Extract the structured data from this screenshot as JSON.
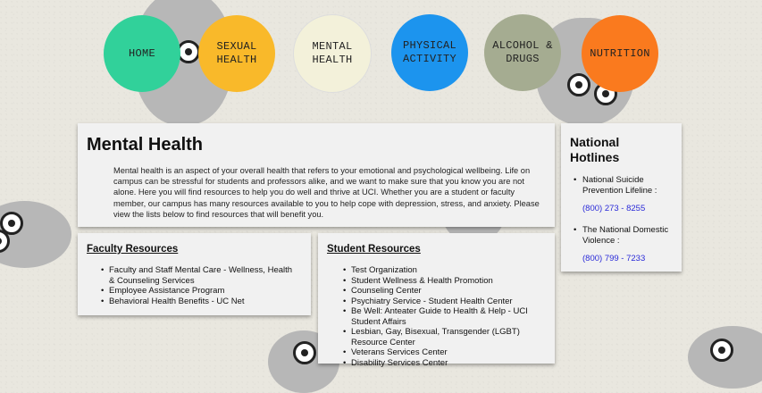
{
  "nav": [
    {
      "label": "HOME",
      "color": "#31d19a"
    },
    {
      "label": "SEXUAL HEALTH",
      "color": "#f9b92a"
    },
    {
      "label": "MENTAL HEALTH",
      "color": "#f3f1da"
    },
    {
      "label": "PHYSICAL ACTIVITY",
      "color": "#1c94ee"
    },
    {
      "label": "ALCOHOL & DRUGS",
      "color": "#a5ac91"
    },
    {
      "label": "NUTRITION",
      "color": "#fa7a1e"
    }
  ],
  "intro": {
    "title": "Mental Health",
    "body": "Mental health is an aspect of your overall health that refers to your emotional and psychological wellbeing. Life on campus can be stressful for students and professors alike, and we want to make sure that you know you are not alone. Here you will find resources to help you do well and thrive at UCI. Whether you are a student or faculty member, our campus has many resources available to you to help cope with depression, stress, and anxiety. Please view the lists below to find resources that will benefit you."
  },
  "hotlines": {
    "title": "National Hotlines",
    "items": [
      {
        "name": "National Suicide Prevention Lifeline :",
        "phone": "(800) 273 - 8255"
      },
      {
        "name": "The National Domestic Violence :",
        "phone": "(800) 799 - 7233"
      }
    ]
  },
  "faculty": {
    "title": "Faculty Resources",
    "items": [
      "Faculty and Staff Mental Care - Wellness, Health & Counseling Services",
      "Employee Assistance Program",
      "Behavioral Health Benefits - UC Net"
    ]
  },
  "student": {
    "title": "Student Resources",
    "items": [
      "Test Organization",
      "Student Wellness & Health Promotion",
      "Counseling Center",
      "Psychiatry Service - Student Health Center",
      "Be Well: Anteater Guide to Health & Help - UCI Student Affairs",
      "Lesbian, Gay, Bisexual, Transgender (LGBT) Resource Center",
      "Veterans Services Center",
      "Disability Services Center"
    ]
  }
}
